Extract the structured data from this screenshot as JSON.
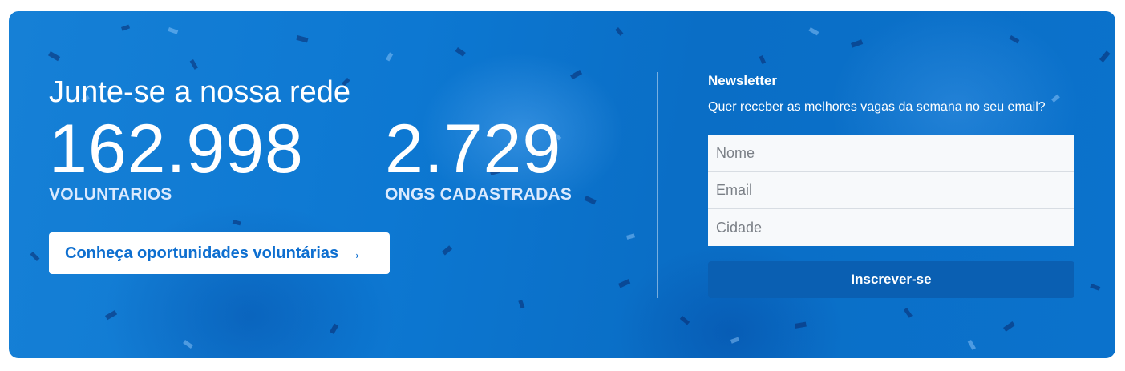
{
  "hero": {
    "heading": "Junte-se a nossa rede",
    "stats": [
      {
        "value": "162.998",
        "label": "VOLUNTARIOS"
      },
      {
        "value": "2.729",
        "label": "ONGS CADASTRADAS"
      }
    ],
    "cta_label": "Conheça oportunidades voluntárias",
    "cta_arrow": "→"
  },
  "newsletter": {
    "title": "Newsletter",
    "subtitle": "Quer receber as melhores vagas da semana no seu email?",
    "fields": [
      {
        "placeholder": "Nome",
        "value": ""
      },
      {
        "placeholder": "Email",
        "value": ""
      },
      {
        "placeholder": "Cidade",
        "value": ""
      }
    ],
    "submit_label": "Inscrever-se"
  },
  "colors": {
    "banner_blue": "#0d78d2",
    "cta_text": "#0e6fd0",
    "submit_bg": "#0a5fb2"
  },
  "background": {
    "image": "celebration-crowd-with-confetti"
  }
}
